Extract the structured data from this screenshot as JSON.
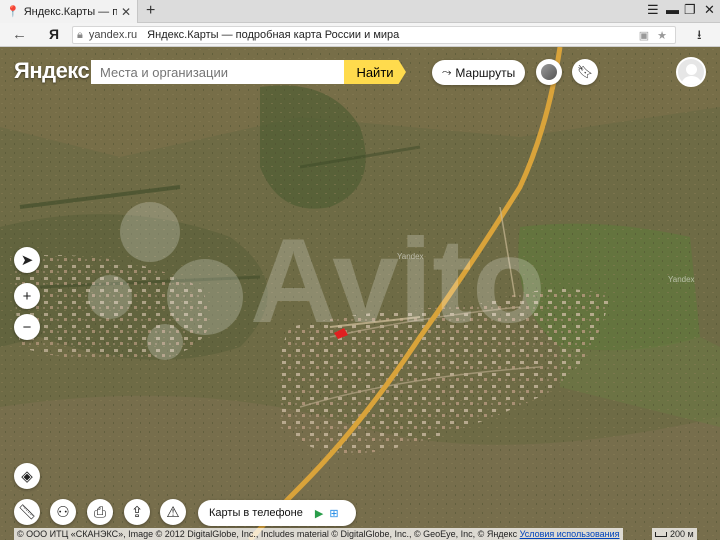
{
  "browser": {
    "tab_title": "Яндекс.Карты — подроб",
    "new_tab": "+",
    "url_domain": "yandex.ru",
    "page_title": "Яндекс.Карты — подробная карта России и мира",
    "ya_button": "Я"
  },
  "map": {
    "logo": "Яндекс",
    "search_placeholder": "Места и организации",
    "find_label": "Найти",
    "routes_label": "Маршруты",
    "phone_label": "Карты в телефоне",
    "watermark_map": "Yandex",
    "watermark_avito": "Avito",
    "copyright": "© ООО ИТЦ «СКАНЭКС», Image © 2012 DigitalGlobe, Inc., Includes material © DigitalGlobe, Inc., © GeoEye, Inc, © Яндекс",
    "terms_label": "Условия использования",
    "scale_label": "200 м"
  },
  "colors": {
    "accent_yellow": "#ffdb4d",
    "road": "#d9a33a",
    "marker": "#e02020"
  },
  "icons": [
    "location-pin-icon",
    "close-icon",
    "menu-icon",
    "minimize-icon",
    "restore-icon",
    "window-close-icon",
    "back-arrow-icon",
    "lock-icon",
    "bookmark-star-icon",
    "download-icon",
    "routes-icon",
    "layers-toggle-icon",
    "bookmark-icon",
    "user-avatar-icon",
    "geolocation-icon",
    "zoom-in-icon",
    "zoom-out-icon",
    "layers-icon",
    "ruler-icon",
    "binoculars-icon",
    "print-icon",
    "share-icon",
    "warning-icon",
    "apple-icon",
    "google-play-icon",
    "windows-icon"
  ]
}
